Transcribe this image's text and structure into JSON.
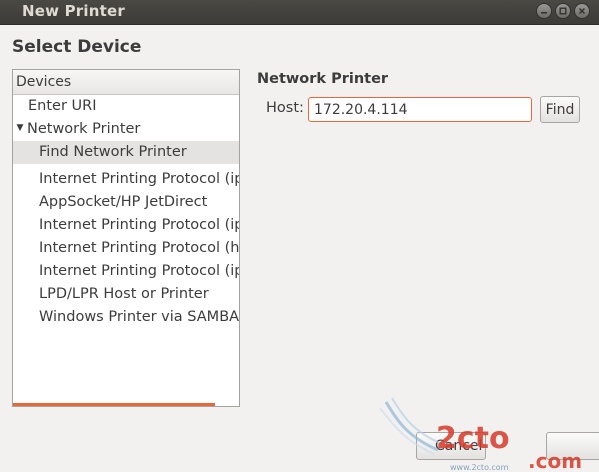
{
  "window": {
    "title": "New Printer"
  },
  "page": {
    "title": "Select Device"
  },
  "device_list": {
    "header": "Devices",
    "items": [
      {
        "label": "Enter URI"
      },
      {
        "label": "Network Printer",
        "expander": "▼"
      },
      {
        "label": "Find Network Printer"
      },
      {
        "label": "Internet Printing Protocol (ipp"
      },
      {
        "label": "AppSocket/HP JetDirect"
      },
      {
        "label": "Internet Printing Protocol (ipp"
      },
      {
        "label": "Internet Printing Protocol (htt"
      },
      {
        "label": "Internet Printing Protocol (ipp"
      },
      {
        "label": "LPD/LPR Host or Printer"
      },
      {
        "label": "Windows Printer via SAMBA"
      }
    ],
    "selected_index": 2
  },
  "network_printer": {
    "section_title": "Network Printer",
    "host_label": "Host:",
    "host_value": "172.20.4.114",
    "find_label": "Find"
  },
  "footer": {
    "cancel_label": "Cancel"
  },
  "colors": {
    "accent": "#e9683a",
    "titlebar": "#3c3b37",
    "background": "#f2f1f0"
  }
}
